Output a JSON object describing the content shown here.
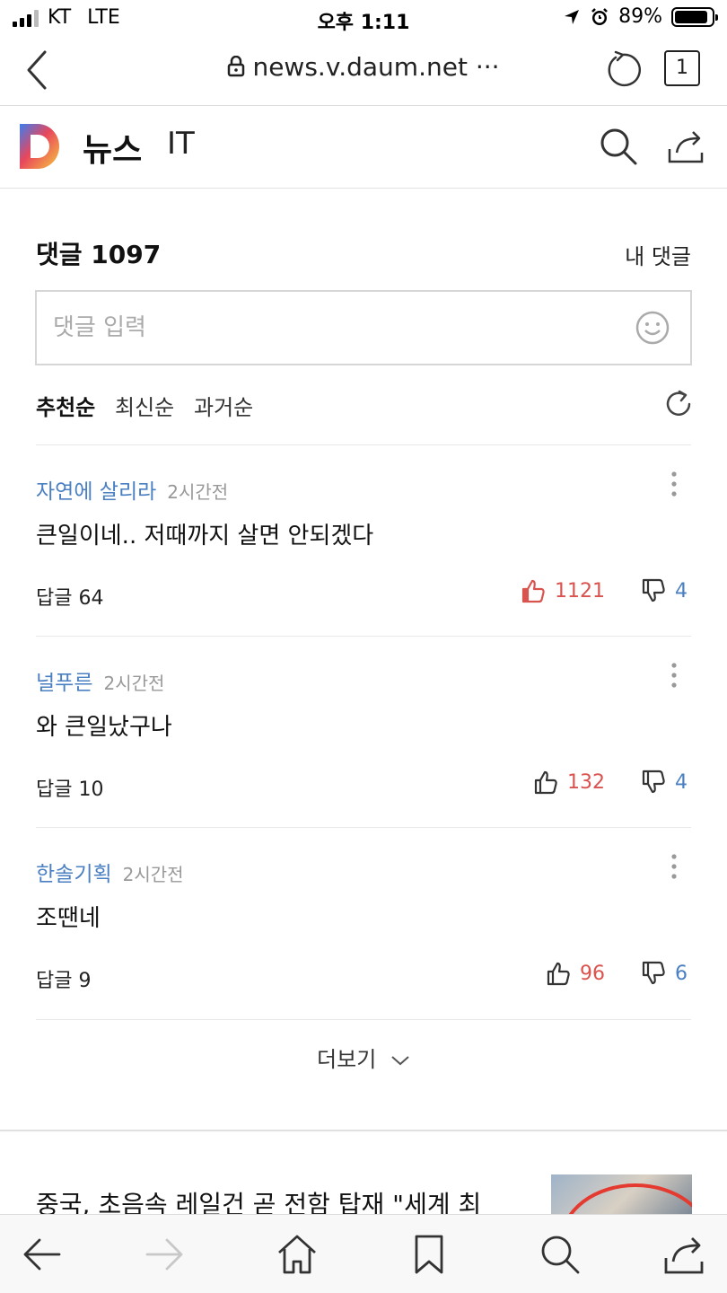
{
  "status_bar": {
    "carrier": "KT",
    "network": "LTE",
    "time": "오후 1:11",
    "battery": "89%"
  },
  "browser": {
    "url": "news.v.daum.net ···",
    "tab_count": "1"
  },
  "header": {
    "brand": "뉴스",
    "section": "IT"
  },
  "comments": {
    "title": "댓글 1097",
    "my_comments": "내 댓글",
    "input_placeholder": "댓글 입력",
    "sort": {
      "recommended": "추천순",
      "latest": "최신순",
      "oldest": "과거순"
    },
    "items": [
      {
        "author": "자연에 살리라",
        "time": "2시간전",
        "body": "큰일이네.. 저때까지 살면 안되겠다",
        "replies": "답글 64",
        "likes": "1121",
        "dislikes": "4"
      },
      {
        "author": "널푸른",
        "time": "2시간전",
        "body": "와 큰일났구나",
        "replies": "답글 10",
        "likes": "132",
        "dislikes": "4"
      },
      {
        "author": "한솔기획",
        "time": "2시간전",
        "body": "조땐네",
        "replies": "답글 9",
        "likes": "96",
        "dislikes": "6"
      }
    ],
    "more": "더보기"
  },
  "next_article": {
    "title": "중국, 초음속 레일건 곧 전함 탑재 \"세계 최"
  },
  "colors": {
    "author_blue": "#4a7fc1",
    "like_red": "#d9534f"
  }
}
